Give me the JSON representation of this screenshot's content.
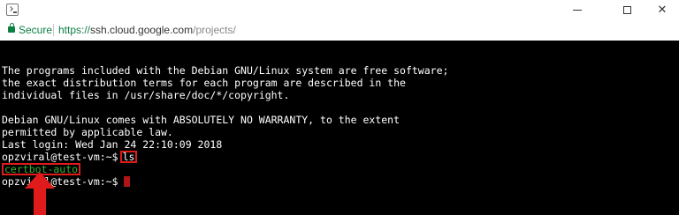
{
  "window": {
    "controls": {
      "minimize": "minimize",
      "maximize": "maximize",
      "close": "✕"
    }
  },
  "addressbar": {
    "secure_label": "Secure",
    "url_scheme": "https://",
    "url_host": "ssh.cloud.google.com",
    "url_path": "/projects/"
  },
  "terminal": {
    "motd": [
      "The programs included with the Debian GNU/Linux system are free software;",
      "the exact distribution terms for each program are described in the",
      "individual files in /usr/share/doc/*/copyright."
    ],
    "warranty": [
      "Debian GNU/Linux comes with ABSOLUTELY NO WARRANTY, to the extent",
      "permitted by applicable law."
    ],
    "last_login": "Last login: Wed Jan 24 22:10:09 2018",
    "prompt": "opzviral@test-vm:~$",
    "command": "ls",
    "output_file": "certbot-auto",
    "prompt2": "opzviral@test-vm:~$"
  },
  "colors": {
    "terminal_bg": "#000000",
    "terminal_text": "#ffffff",
    "output_green": "#2fb52f",
    "annotation_red": "#e01b1b",
    "secure_green": "#0b8043"
  },
  "icons": {
    "app": "terminal-app-icon",
    "lock": "lock-icon",
    "arrow": "red-up-arrow-annotation"
  }
}
